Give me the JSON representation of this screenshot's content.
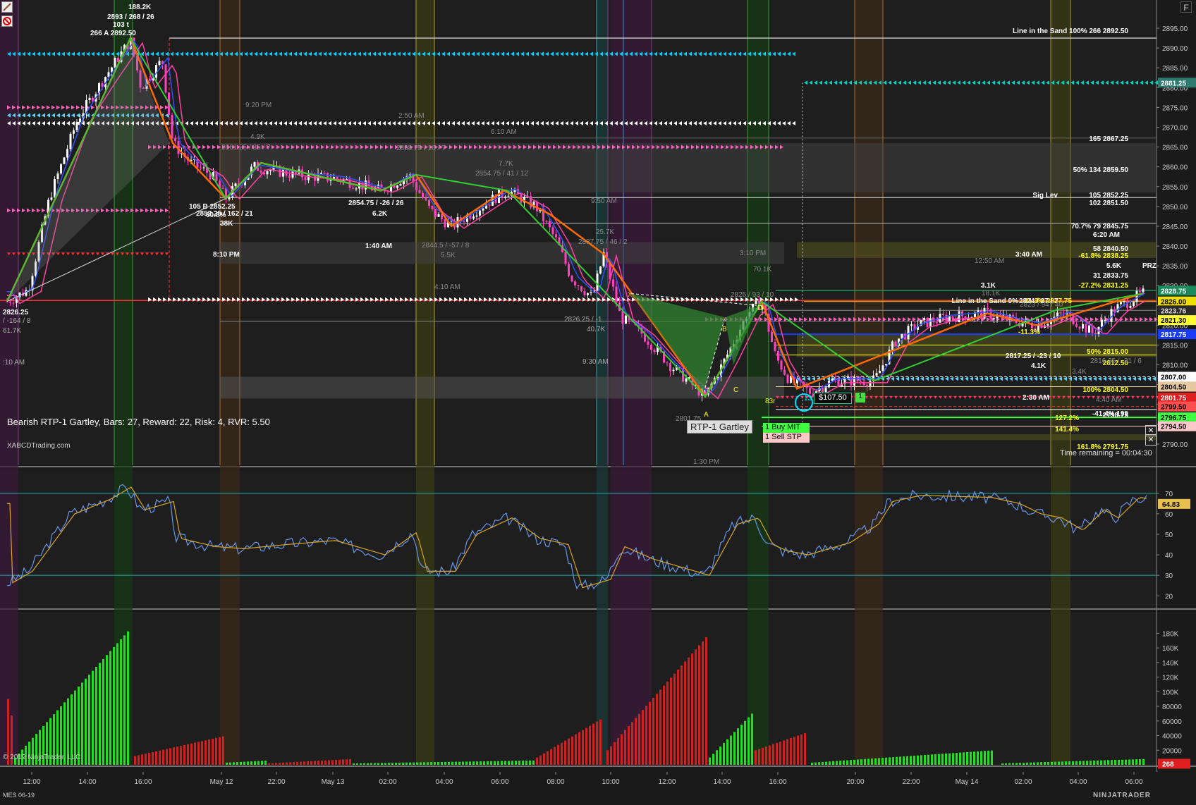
{
  "window": {
    "instrument": "MES 06-19",
    "copyright": "© 2019 NinjaTrader, LLC",
    "brand": "NINJATRADER",
    "f_button": "F",
    "watermark": "XABCDTrading.com"
  },
  "pattern_info": "Bearish RTP-1 Gartley, Bars: 27, Reward: 22, Risk: 4, RVR: 5.50",
  "pattern_label": "RTP-1 Gartley",
  "orders": {
    "buy": "1  Buy MIT",
    "sell": "1  Sell STP",
    "pnl": "$107.50",
    "qty": "1"
  },
  "time_remaining": "Time remaining = 00:04:30",
  "price_axis": [
    "2895.00",
    "2890.00",
    "2885.00",
    "2880.00",
    "2875.00",
    "2870.00",
    "2865.00",
    "2860.00",
    "2855.00",
    "2850.00",
    "2845.00",
    "2840.00",
    "2835.00",
    "2830.00",
    "2825.00",
    "2820.00",
    "2815.00",
    "2810.00",
    "2805.00",
    "2800.00",
    "2795.00",
    "2790.00"
  ],
  "osc_axis": [
    "70",
    "60",
    "50",
    "40",
    "30",
    "20"
  ],
  "vol_axis": [
    "180K",
    "160K",
    "140K",
    "120K",
    "100K",
    "80000",
    "60000",
    "40000",
    "20000"
  ],
  "time_axis": [
    "12:00",
    "14:00",
    "16:00",
    "May 12",
    "22:00",
    "May 13",
    "02:00",
    "04:00",
    "06:00",
    "08:00",
    "10:00",
    "12:00",
    "14:00",
    "16:00",
    "20:00",
    "22:00",
    "May 14",
    "02:00",
    "04:00",
    "06:00"
  ],
  "price_badges": [
    {
      "text": "2881.25",
      "bg": "#2f7a6e",
      "fg": "#ffffff"
    },
    {
      "text": "2828.75",
      "bg": "#1c8a5a",
      "fg": "#ffffff"
    },
    {
      "text": "2826.00",
      "bg": "#f0e000",
      "fg": "#000000"
    },
    {
      "text": "2823.76",
      "bg": "#2a2a2a",
      "fg": "#dddddd"
    },
    {
      "text": "2821.30",
      "bg": "#ffff33",
      "fg": "#000000"
    },
    {
      "text": "2817.75",
      "bg": "#1a3cff",
      "fg": "#ffffff"
    },
    {
      "text": "2807.00",
      "bg": "#ffffff",
      "fg": "#000000"
    },
    {
      "text": "2804.50",
      "bg": "#e8c8a0",
      "fg": "#000000"
    },
    {
      "text": "2801.75",
      "bg": "#e02020",
      "fg": "#ffffff"
    },
    {
      "text": "2799.50",
      "bg": "#ff5050",
      "fg": "#000000"
    },
    {
      "text": "2796.75",
      "bg": "#40ff40",
      "fg": "#000000"
    },
    {
      "text": "2794.50",
      "bg": "#ffc8c8",
      "fg": "#000000"
    }
  ],
  "osc_badge": "64.83",
  "vol_badge": "268",
  "level_labels": [
    {
      "text": "Line in the Sand    100%    266    2892.50",
      "color": "#ffffff"
    },
    {
      "text": "165    2867.25",
      "color": "#ffffff"
    },
    {
      "text": "50%    134    2859.50",
      "color": "#ffffff"
    },
    {
      "text": "Sig Lev",
      "color": "#ffffff"
    },
    {
      "text": "105    2852.25",
      "color": "#ffffff"
    },
    {
      "text": "102    2851.50",
      "color": "#ffffff"
    },
    {
      "text": "70.7%    79    2845.75",
      "color": "#ffffff"
    },
    {
      "text": "6:20 AM",
      "color": "#ffffff"
    },
    {
      "text": "58    2840.50",
      "color": "#ffffff"
    },
    {
      "text": "3:40 AM",
      "color": "#ffffff"
    },
    {
      "text": "-61.8%    2838.25",
      "color": "#ffff00"
    },
    {
      "text": "5.6K",
      "color": "#ffffff"
    },
    {
      "text": "31    2833.75",
      "color": "#ffffff"
    },
    {
      "text": "3.1K",
      "color": "#ffffff"
    },
    {
      "text": "-27.2%    2831.25",
      "color": "#ffff00"
    },
    {
      "text": "-11.3%    2827.75",
      "color": "#ffff00"
    },
    {
      "text": "Line in the Sand    0%",
      "color": "#ffffff"
    },
    {
      "text": "-11.3%",
      "color": "#ffff00"
    },
    {
      "text": "50%    2815.00",
      "color": "#ffff00"
    },
    {
      "text": "2812.50",
      "color": "#ffff00"
    },
    {
      "text": "100%    2804.50",
      "color": "#ffff00"
    },
    {
      "text": "-41.4%    199",
      "color": "#ffffff"
    },
    {
      "text": "127.2%",
      "color": "#ffff00"
    },
    {
      "text": "2798.75",
      "color": "#ffffff"
    },
    {
      "text": "141.4%",
      "color": "#ffff00"
    },
    {
      "text": "161.8%    2791.75",
      "color": "#ffff00"
    }
  ],
  "chart_labels": [
    {
      "text": "188.2K",
      "color": "#ffffff"
    },
    {
      "text": "2893 / 268 / 26",
      "color": "#ffffff"
    },
    {
      "text": "103 t",
      "color": "#ffffff"
    },
    {
      "text": "266    A    2892.50",
      "color": "#ffffff"
    },
    {
      "text": "2826.25",
      "color": "#ffffff"
    },
    {
      "text": "/ -164 / 8",
      "color": "#aaaaaa"
    },
    {
      "text": "61.7K",
      "color": "#aaaaaa"
    },
    {
      "text": ":10 AM",
      "color": "#aaaaaa"
    },
    {
      "text": "9:20 PM",
      "color": "#888888"
    },
    {
      "text": "2:50 AM",
      "color": "#888888"
    },
    {
      "text": "6:10 AM",
      "color": "#888888"
    },
    {
      "text": "4.9K",
      "color": "#888888"
    },
    {
      "text": "2861.25 / 35 / 7",
      "color": "#888888"
    },
    {
      "text": "2858.75 / 16 / 7",
      "color": "#888888"
    },
    {
      "text": "7.7K",
      "color": "#888888"
    },
    {
      "text": "2854.75 / 41 / 12",
      "color": "#888888"
    },
    {
      "text": "105    B    2852.25",
      "color": "#ffffff"
    },
    {
      "text": "2852.25 / 162 / 21",
      "color": "#ffffff"
    },
    {
      "text": "60.8%",
      "color": "#ffffff"
    },
    {
      "text": "38K",
      "color": "#ffffff"
    },
    {
      "text": "2854.75 / -26 / 26",
      "color": "#ffffff"
    },
    {
      "text": "6.2K",
      "color": "#ffffff"
    },
    {
      "text": "9:50 AM",
      "color": "#888888"
    },
    {
      "text": "25.7K",
      "color": "#888888"
    },
    {
      "text": "2837.75 / 46 / 2",
      "color": "#888888"
    },
    {
      "text": "2844.5 / -57 / 8",
      "color": "#888888"
    },
    {
      "text": "5.5K",
      "color": "#888888"
    },
    {
      "text": "8:10 PM",
      "color": "#ffffff"
    },
    {
      "text": "1:40 AM",
      "color": "#ffffff"
    },
    {
      "text": "4:10 AM",
      "color": "#888888"
    },
    {
      "text": "3:10 PM",
      "color": "#888888"
    },
    {
      "text": "70.1K",
      "color": "#888888"
    },
    {
      "text": "2825 / 93 / 10",
      "color": "#888888"
    },
    {
      "text": "2826.25 / -1",
      "color": "#aaaaaa"
    },
    {
      "text": "40.7K",
      "color": "#aaaaaa"
    },
    {
      "text": "9:30 AM",
      "color": "#aaaaaa"
    },
    {
      "text": "X",
      "color": "#ffa500"
    },
    {
      "text": "B",
      "color": "#ffff00"
    },
    {
      "text": "C",
      "color": "#ffff00"
    },
    {
      "text": "D",
      "color": "#ffff00"
    },
    {
      "text": "A",
      "color": "#ffff00"
    },
    {
      "text": "12:50 AM",
      "color": "#888888"
    },
    {
      "text": "18.1K",
      "color": "#888888"
    },
    {
      "text": "2823 / 94 / 40",
      "color": "#888888"
    },
    {
      "text": "2824 / 27 / 7",
      "color": "#ffffff"
    },
    {
      "text": "2817.25 / -23 / 10",
      "color": "#ffffff"
    },
    {
      "text": "4.1K",
      "color": "#ffffff"
    },
    {
      "text": "2816.25 / -31 / 6",
      "color": "#888888"
    },
    {
      "text": "3.4K",
      "color": "#888888"
    },
    {
      "text": "2:30 AM",
      "color": "#ffffff"
    },
    {
      "text": "4:40 AM",
      "color": "#888888"
    },
    {
      "text": "1:30 PM",
      "color": "#888888"
    },
    {
      "text": "83r",
      "color": "#ffff00"
    },
    {
      "text": "13",
      "color": "#00ffff"
    },
    {
      "text": "PRZ",
      "color": "#ffffff"
    },
    {
      "text": "2801.75",
      "color": "#888888"
    }
  ],
  "colors": {
    "bg": "#1a1a1a",
    "grid": "#2a2a2a",
    "up": "#00c800",
    "down": "#d02020",
    "ema_fast": "#6495ed",
    "ema_slow": "#daa520",
    "zigzag_green": "#32cd32",
    "zigzag_blue": "#1e3cff",
    "zigzag_orange": "#ff6a00"
  }
}
